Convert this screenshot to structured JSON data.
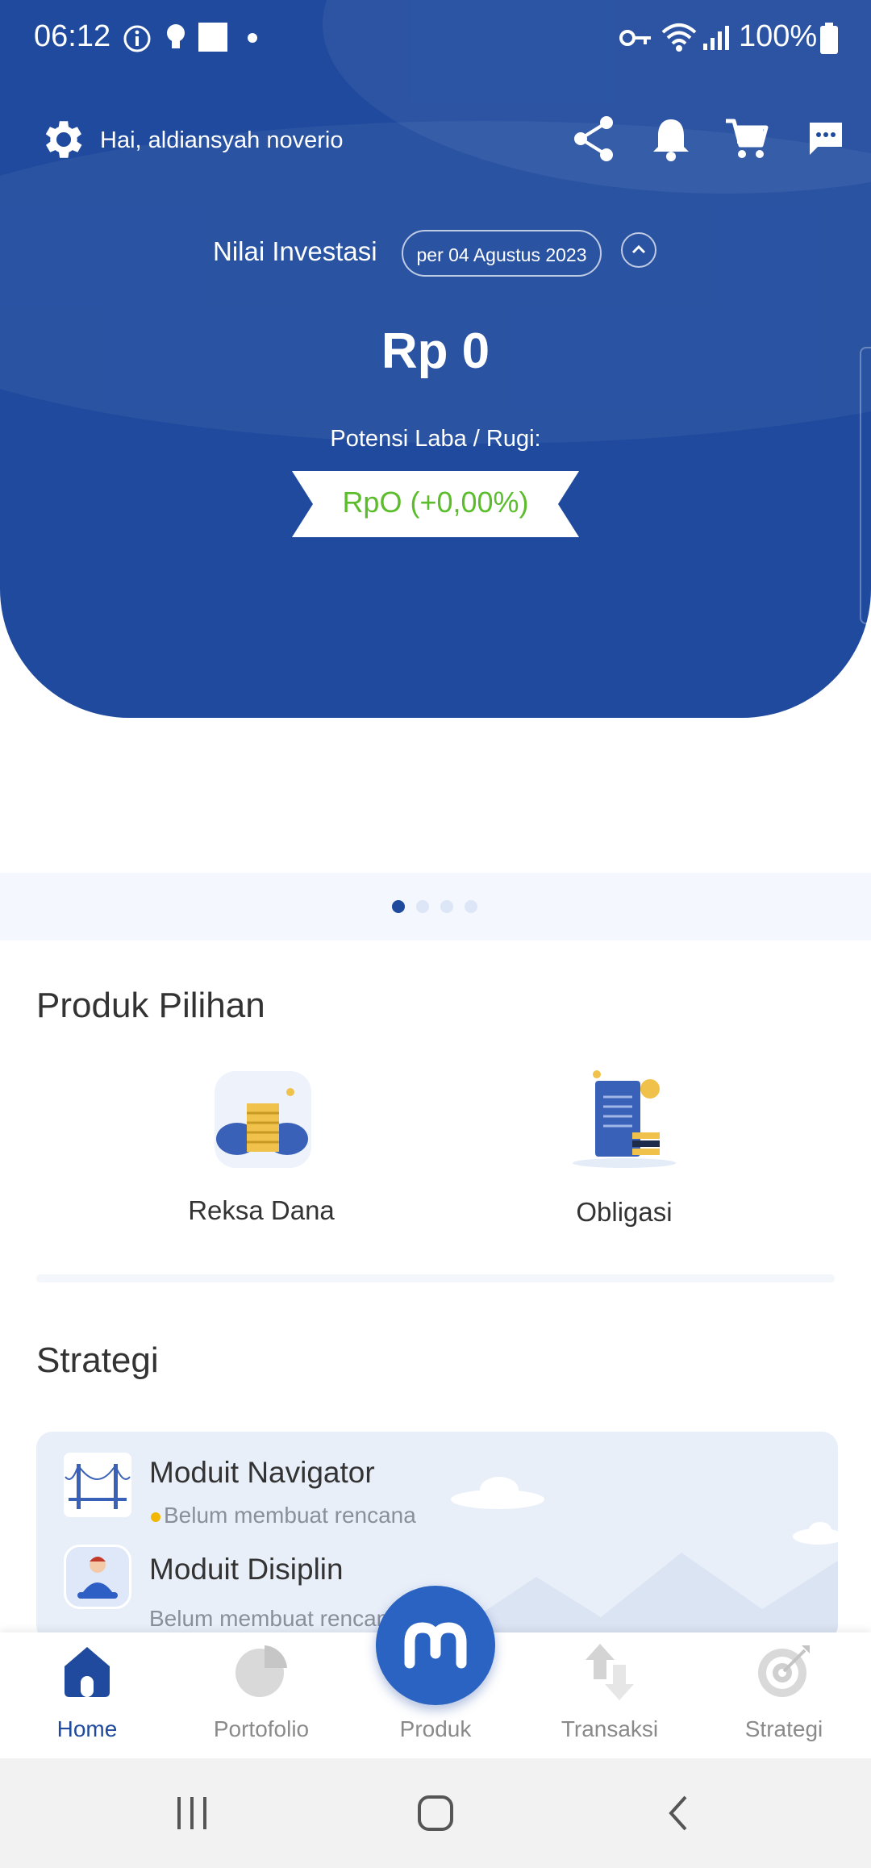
{
  "status_bar": {
    "time": "06:12",
    "battery": "100%"
  },
  "header": {
    "greeting": "Hai, aldiansyah noverio",
    "investment_label": "Nilai Investasi",
    "date": "per 04 Agustus 2023",
    "amount": "Rp 0",
    "profit_label": "Potensi Laba / Rugi:",
    "profit_value": "RpO (+0,00%)"
  },
  "carousel": {
    "pages": 4,
    "active": 0
  },
  "products": {
    "title": "Produk Pilihan",
    "items": [
      {
        "label": "Reksa Dana"
      },
      {
        "label": "Obligasi"
      }
    ]
  },
  "strategy": {
    "title": "Strategi",
    "items": [
      {
        "title": "Moduit Navigator",
        "subtitle": "Belum membuat rencana"
      },
      {
        "title": "Moduit Disiplin",
        "subtitle": "Belum membuat rencana"
      }
    ]
  },
  "bottom_nav": {
    "items": [
      {
        "label": "Home",
        "icon": "home-icon",
        "active": true
      },
      {
        "label": "Portofolio",
        "icon": "pie-chart-icon",
        "active": false
      },
      {
        "label": "Produk",
        "icon": "moduit-logo-icon",
        "active": false
      },
      {
        "label": "Transaksi",
        "icon": "transfer-arrows-icon",
        "active": false
      },
      {
        "label": "Strategi",
        "icon": "target-icon",
        "active": false
      }
    ]
  },
  "colors": {
    "primary": "#1f4a9e",
    "profit": "#5bbd2b",
    "pending_dot": "#f2b705"
  }
}
